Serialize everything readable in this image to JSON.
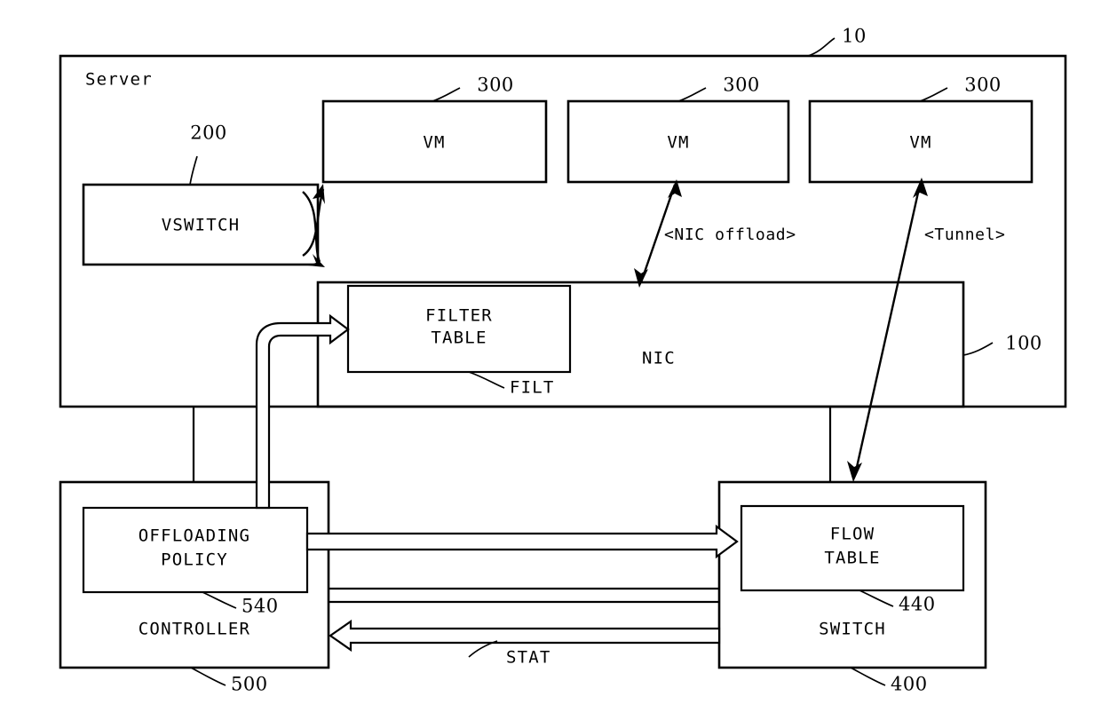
{
  "figure": {
    "server": {
      "label": "Server",
      "ref": "10"
    },
    "vswitch": {
      "label": "VSWITCH",
      "ref": "200"
    },
    "vms": [
      {
        "label": "VM",
        "ref": "300"
      },
      {
        "label": "VM",
        "ref": "300"
      },
      {
        "label": "VM",
        "ref": "300"
      }
    ],
    "nic": {
      "label": "NIC",
      "ref": "100"
    },
    "filter_table": {
      "line1": "FILTER",
      "line2": "TABLE",
      "ref": "FILT"
    },
    "controller": {
      "label": "CONTROLLER",
      "ref": "500"
    },
    "offloading_policy": {
      "line1": "OFFLOADING",
      "line2": "POLICY",
      "ref": "540"
    },
    "switch": {
      "label": "SWITCH",
      "ref": "400"
    },
    "flow_table": {
      "line1": "FLOW",
      "line2": "TABLE",
      "ref": "440"
    },
    "annotations": {
      "nic_offload": "<NIC offload>",
      "tunnel": "<Tunnel>",
      "stat": "STAT"
    },
    "colors": {
      "stroke": "#000000",
      "background": "#ffffff"
    }
  }
}
